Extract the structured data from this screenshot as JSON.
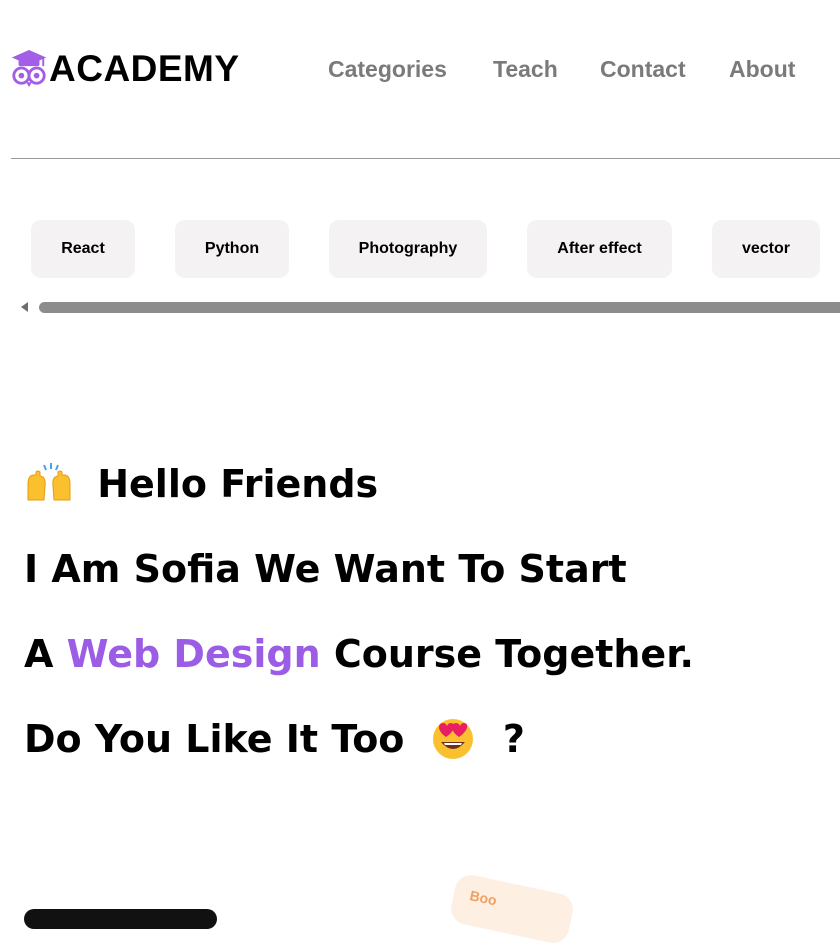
{
  "brand": {
    "name": "ACADEMY",
    "icon": "owl-graduation-cap-icon",
    "icon_color": "#a35de6"
  },
  "nav": {
    "items": [
      {
        "label": "Categories"
      },
      {
        "label": "Teach"
      },
      {
        "label": "Contact"
      },
      {
        "label": "About"
      }
    ],
    "color": "#7a7a7a"
  },
  "categories": {
    "chips": [
      {
        "label": "React"
      },
      {
        "label": "Python"
      },
      {
        "label": "Photography"
      },
      {
        "label": "After effect"
      },
      {
        "label": "vector"
      }
    ],
    "chip_bg": "#f4f2f2"
  },
  "hero": {
    "line1_emoji": "raising-hands-emoji",
    "line1_text": "Hello Friends",
    "line2": "I Am Sofia We Want To Start",
    "line3_prefix": "A ",
    "line3_highlight": "Web Design",
    "line3_suffix": " Course Together.",
    "line4_text": "Do You Like It Too",
    "line4_emoji": "heart-eyes-emoji",
    "line4_end": "?",
    "accent_color": "#9b5de5"
  },
  "decor": {
    "book_label": "Boo"
  }
}
